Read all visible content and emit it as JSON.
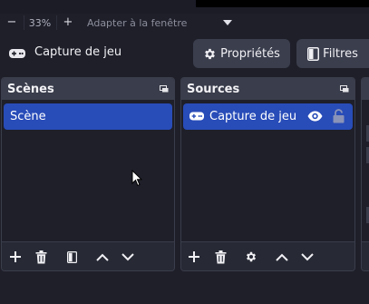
{
  "zoombar": {
    "minus": "−",
    "percent": "33%",
    "plus": "+",
    "fit_label": "Adapter à la fenêtre"
  },
  "source_toolbar": {
    "source_name": "Capture de jeu",
    "properties_label": "Propriétés",
    "filters_label": "Filtres"
  },
  "scenes": {
    "title": "Scènes",
    "items": [
      {
        "label": "Scène",
        "selected": true
      }
    ]
  },
  "sources": {
    "title": "Sources",
    "items": [
      {
        "label": "Capture de jeu",
        "icon": "gamepad-icon",
        "visible": true,
        "locked": false,
        "selected": true
      }
    ]
  },
  "colors": {
    "background": "#1e1f29",
    "panel": "#272a35",
    "header": "#3a3d4b",
    "selection": "#284cb8",
    "button": "#3b3e4d"
  }
}
